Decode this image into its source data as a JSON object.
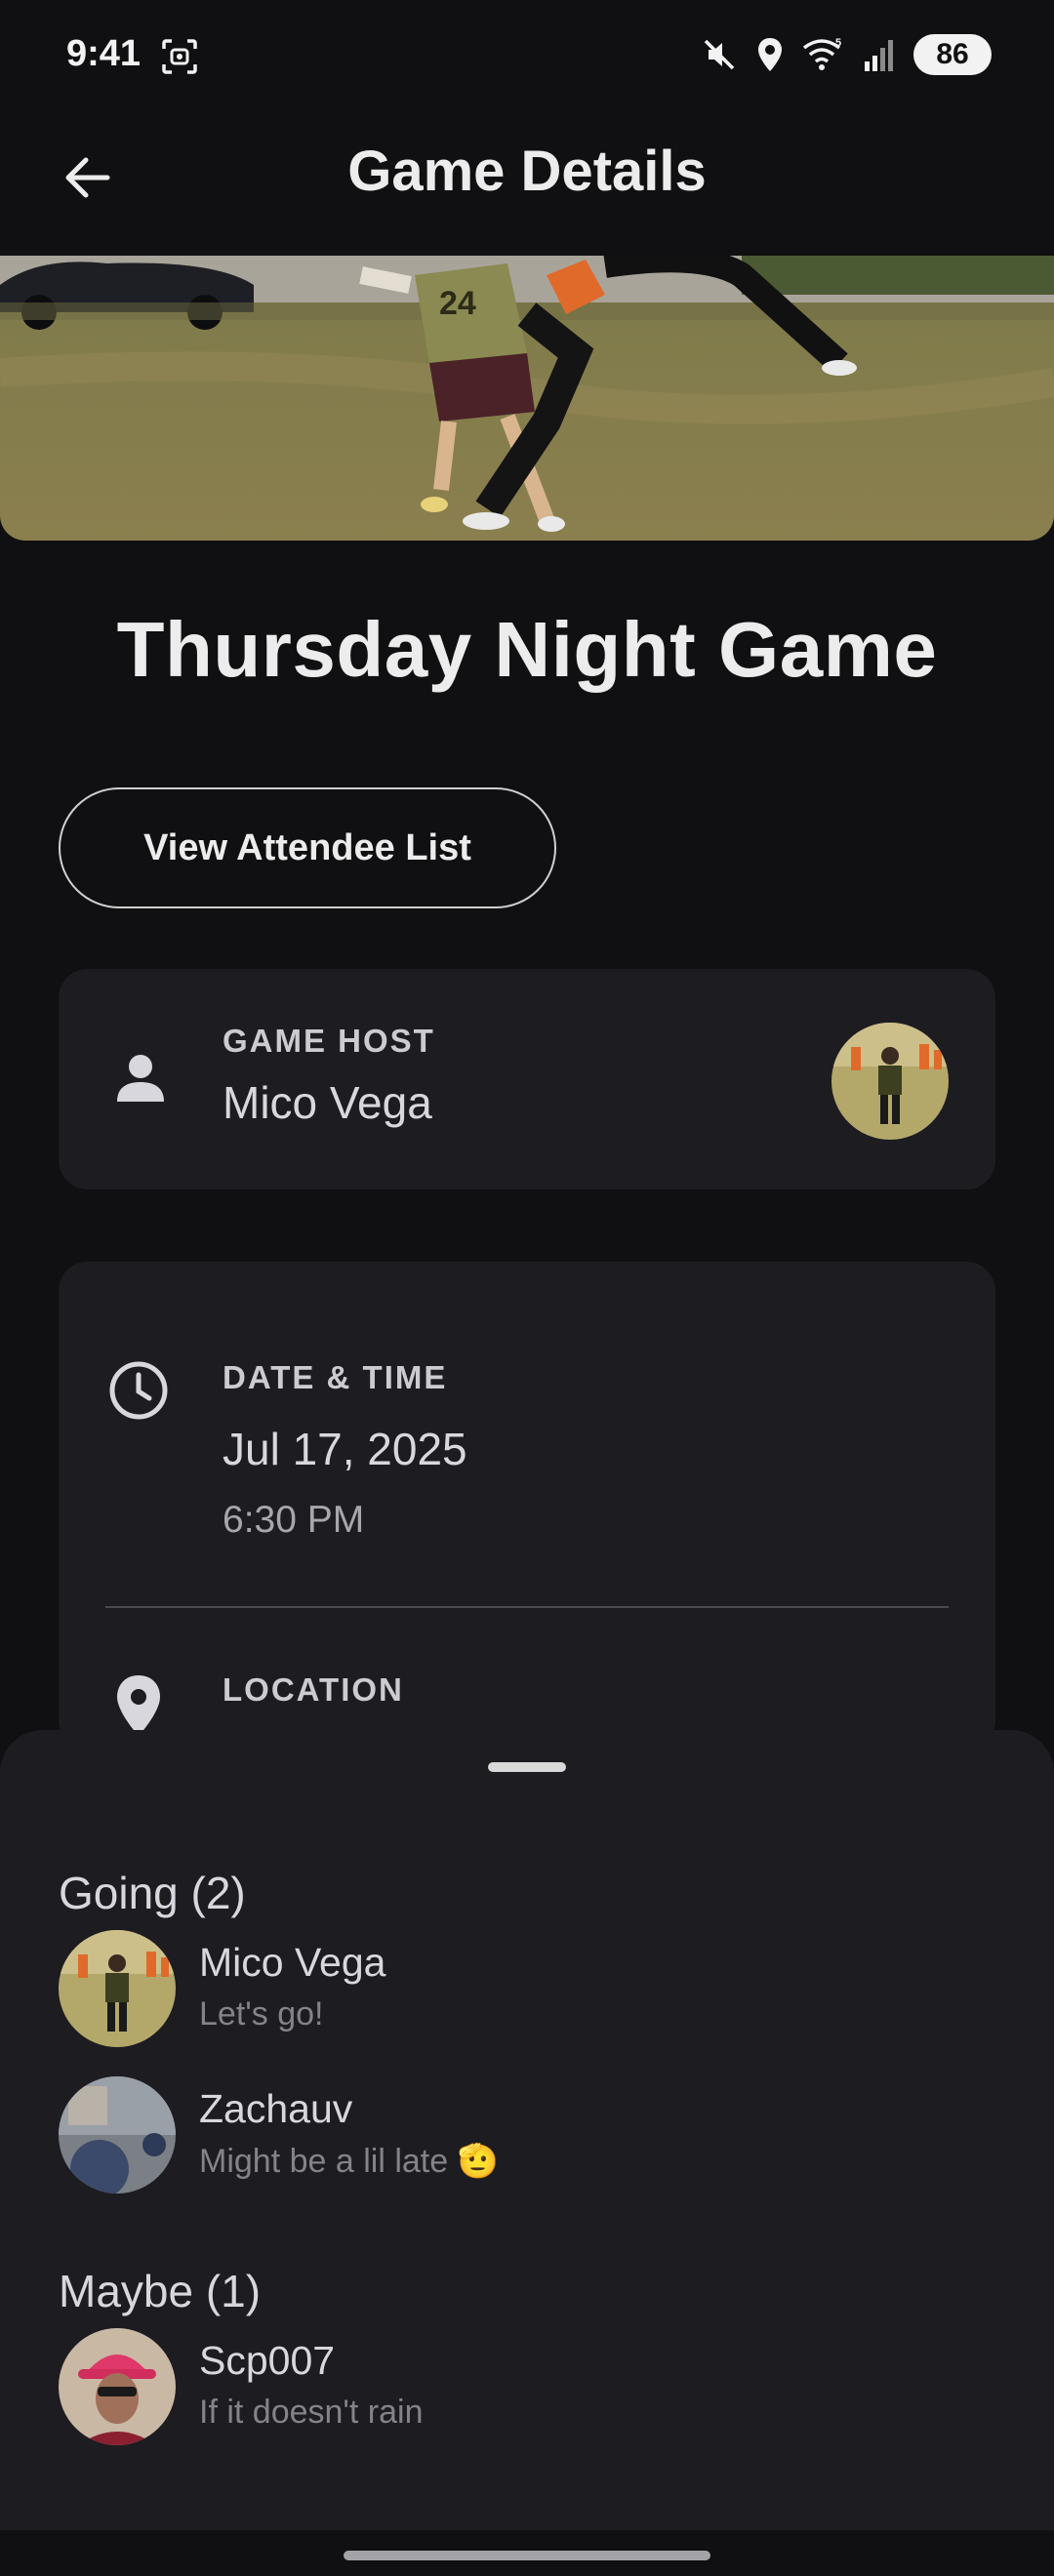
{
  "status_bar": {
    "time": "9:41",
    "battery": "86",
    "icons": [
      "screenshot-icon",
      "mute-icon",
      "location-icon",
      "wifi-icon",
      "signal-icon",
      "battery-icon"
    ]
  },
  "app_bar": {
    "title": "Game Details",
    "back_icon": "arrow-left-icon"
  },
  "game": {
    "title": "Thursday Night Game",
    "attendee_button": "View Attendee List"
  },
  "host": {
    "label": "GAME HOST",
    "name": "Mico Vega",
    "icon": "person-icon"
  },
  "details": {
    "date_label": "DATE & TIME",
    "date": "Jul 17, 2025",
    "time": "6:30 PM",
    "location_label": "LOCATION"
  },
  "sheet": {
    "going_title": "Going (2)",
    "maybe_title": "Maybe (1)",
    "going": [
      {
        "name": "Mico Vega",
        "note": "Let's go!"
      },
      {
        "name": "Zachauv",
        "note": "Might be a lil late 🫡"
      }
    ],
    "maybe": [
      {
        "name": "Scp007",
        "note": "If it doesn't rain"
      }
    ]
  },
  "colors": {
    "background": "#101012",
    "card": "#1d1c21",
    "text_primary": "#ececec",
    "text_secondary": "#85838a"
  }
}
